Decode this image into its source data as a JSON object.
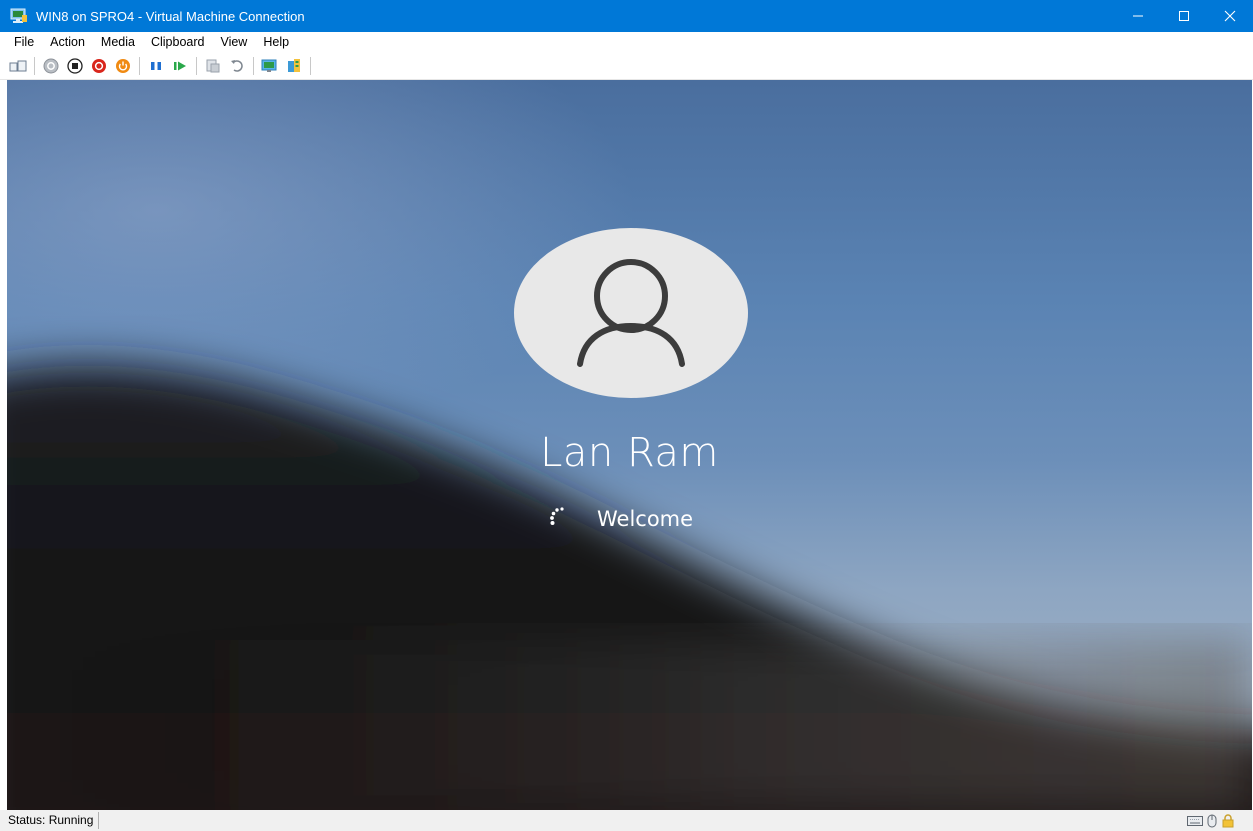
{
  "window": {
    "title": "WIN8 on SPRO4 - Virtual Machine Connection",
    "controls": {
      "minimize": "—",
      "maximize": "☐",
      "close": "✕"
    }
  },
  "menu": {
    "items": [
      "File",
      "Action",
      "Media",
      "Clipboard",
      "View",
      "Help"
    ]
  },
  "toolbar": {
    "buttons": [
      "ctrl-alt-del-icon",
      "start-icon",
      "turn-off-icon",
      "shut-down-icon",
      "save-icon",
      "pause-icon",
      "resume-icon",
      "checkpoint-icon",
      "revert-icon",
      "enhanced-session-icon",
      "share-icon"
    ]
  },
  "vm_screen": {
    "user_name": "Lan Ram",
    "status_message": "Welcome"
  },
  "statusbar": {
    "status": "Status: Running"
  },
  "colors": {
    "titlebar": "#0078d7",
    "avatar_bg": "#e8e8e8",
    "avatar_glyph": "#3c3c3c"
  }
}
